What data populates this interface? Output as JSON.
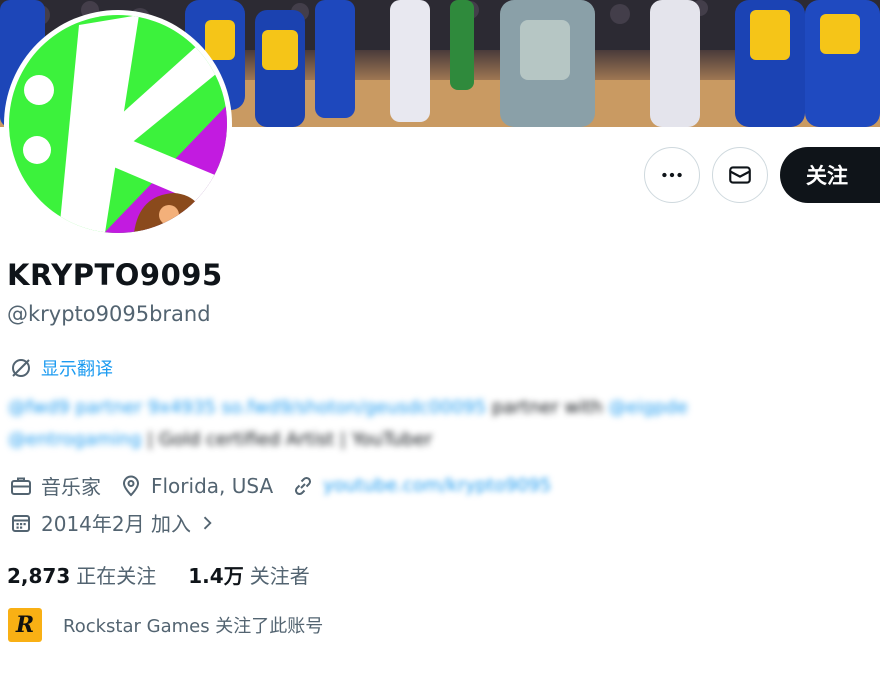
{
  "profile": {
    "display_name": "KRYPTO9095",
    "handle": "@krypto9095brand",
    "translate_label": "显示翻译",
    "bio_line_1": [
      "@fwd9 partner 9x4935 ",
      "so.fwd9/shoton/geusdc00095 ",
      "partner with ",
      "@eigpde"
    ],
    "bio_line_2": [
      "@entrogaming ",
      "| Gold certified Artist | YouTuber"
    ],
    "category": "音乐家",
    "location": "Florida, USA",
    "website": "youtube.com/krypto9095",
    "joined": "2014年2月 加入",
    "following_count": "2,873",
    "following_label": "正在关注",
    "followers_count": "1.4万",
    "followers_label": "关注者",
    "followed_by_text": "Rockstar Games 关注了此账号",
    "followed_by_logo_letter": "R"
  },
  "actions": {
    "more_icon": "ellipsis-icon",
    "message_icon": "mail-icon",
    "follow_label": "关注"
  },
  "colors": {
    "link": "#1d9bf0",
    "text_primary": "#0f1419",
    "text_secondary": "#536471",
    "follow_bg": "#0f1419",
    "rockstar_yellow": "#f9b014",
    "avatar_green": "#3cf23c",
    "avatar_purple": "#c21be0"
  }
}
